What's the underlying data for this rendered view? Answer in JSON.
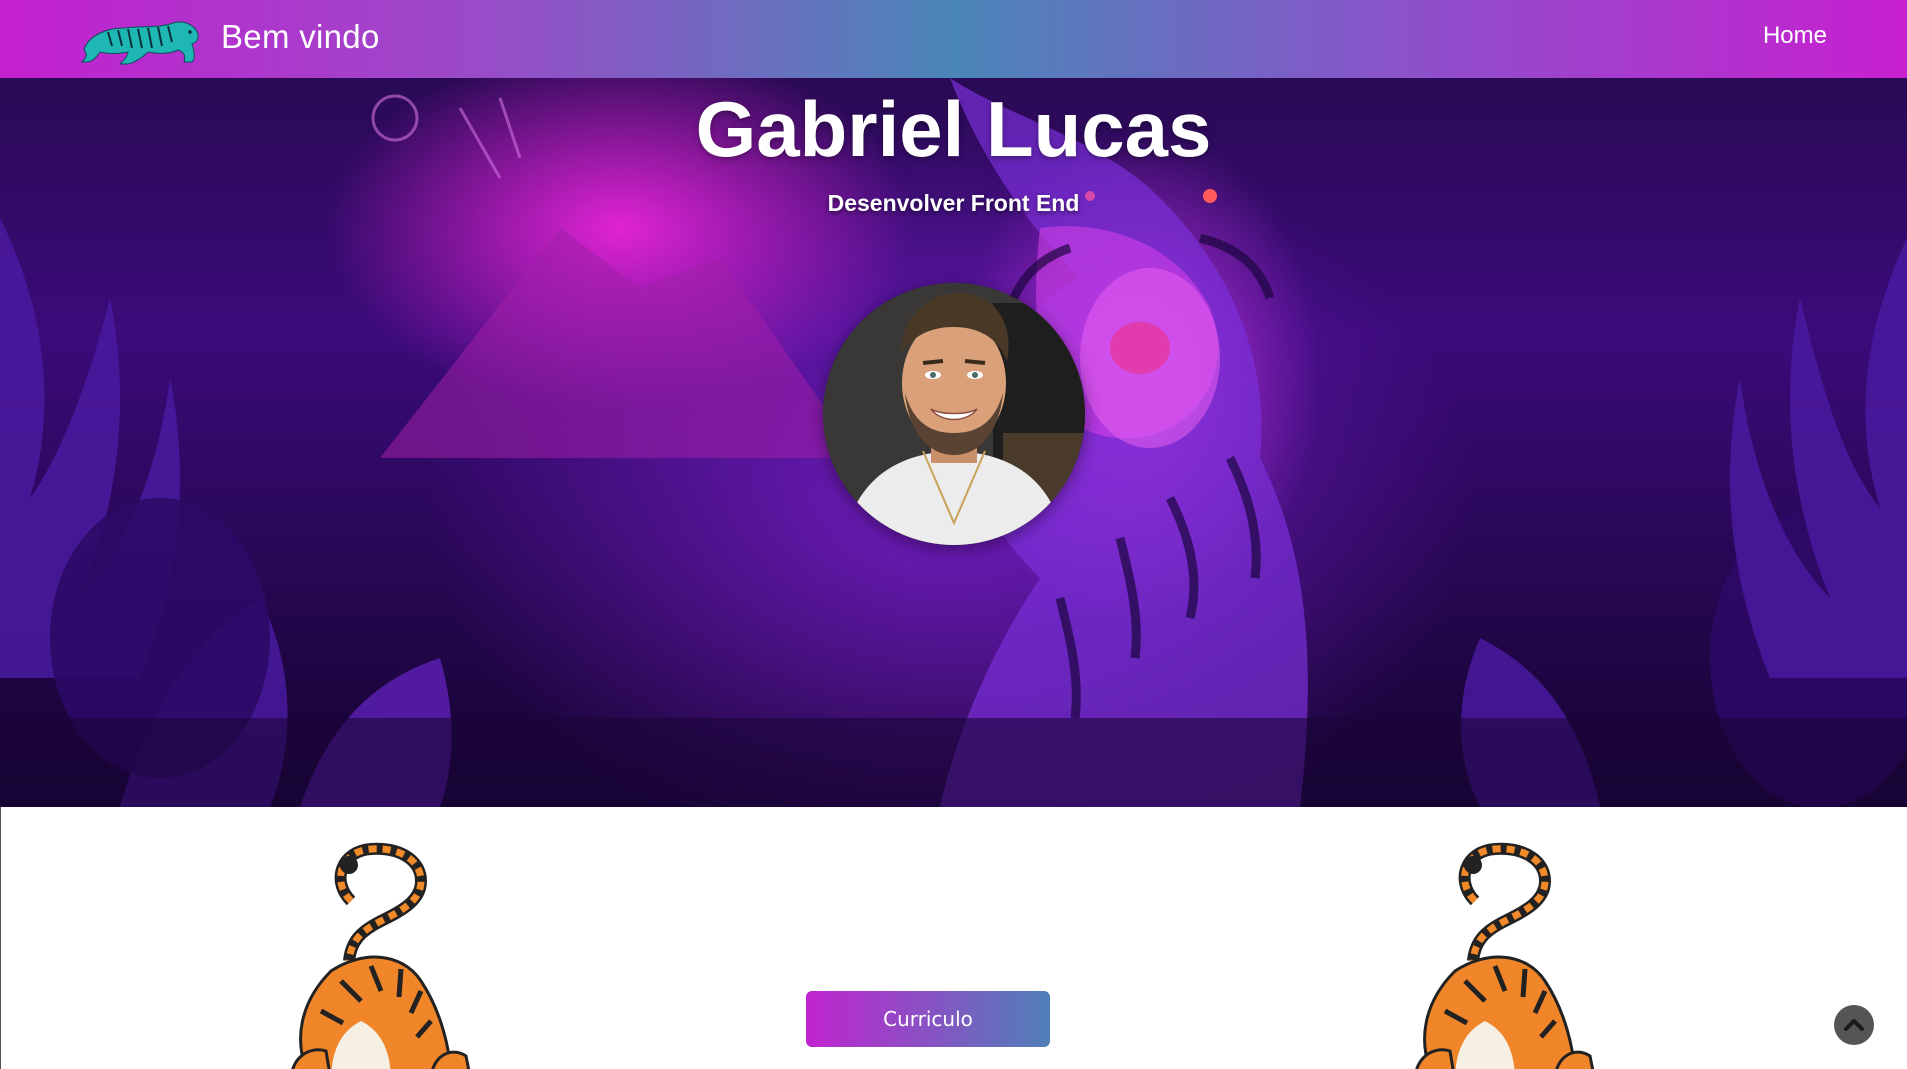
{
  "navbar": {
    "brand_text": "Bem vindo",
    "logo_icon": "tiger-logo-icon",
    "home_link": "Home"
  },
  "hero": {
    "title": "Gabriel Lucas",
    "subtitle": "Desenvolver Front End",
    "avatar": "profile-photo"
  },
  "main": {
    "cv_button": "Curriculo",
    "decor_left": "tiger-illustration-icon",
    "decor_right": "tiger-illustration-icon"
  },
  "scroll_top": {
    "icon": "chevron-up-icon"
  },
  "colors": {
    "nav_gradient_start": "#c41fd0",
    "nav_gradient_mid": "#4a86b8",
    "button_gradient_start": "#c124cf",
    "button_gradient_end": "#4f80b8",
    "hero_magenta": "#ff28e6",
    "hero_purple": "#3b0b7a"
  }
}
